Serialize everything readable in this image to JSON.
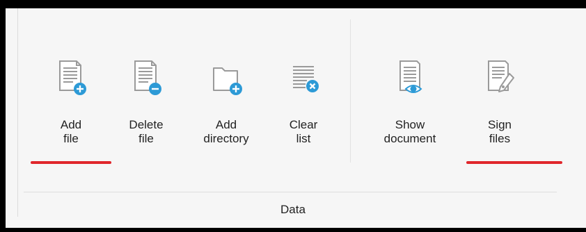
{
  "ribbon": {
    "group_label": "Data",
    "buttons": [
      {
        "line1": "Add",
        "line2": "file",
        "icon": "add-file-icon"
      },
      {
        "line1": "Delete",
        "line2": "file",
        "icon": "delete-file-icon"
      },
      {
        "line1": "Add",
        "line2": "directory",
        "icon": "add-directory-icon"
      },
      {
        "line1": "Clear",
        "line2": "list",
        "icon": "clear-list-icon"
      },
      {
        "line1": "Show",
        "line2": "document",
        "icon": "show-document-icon"
      },
      {
        "line1": "Sign",
        "line2": "files",
        "icon": "sign-files-icon"
      }
    ]
  },
  "colors": {
    "icon_gray": "#9a9a9a",
    "icon_blue": "#2d9ad6",
    "highlight_red": "#e0262b"
  }
}
